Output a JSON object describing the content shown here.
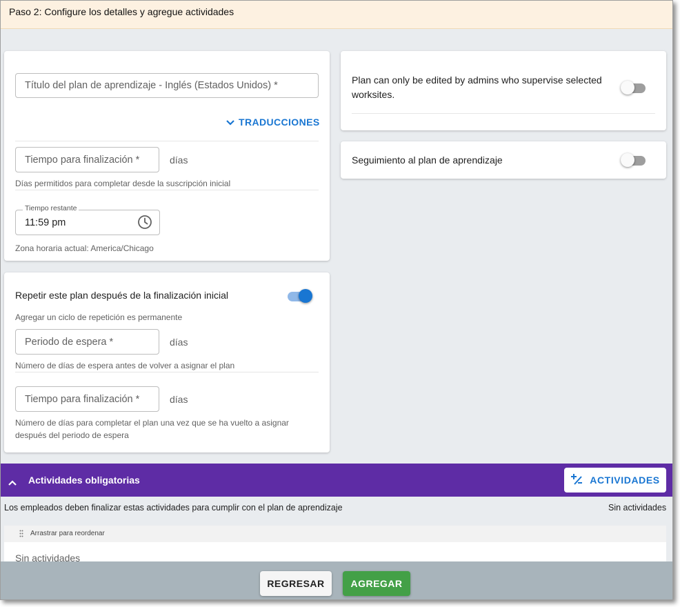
{
  "header": {
    "title": "Paso 2: Configure los detalles y agregue actividades"
  },
  "details_card": {
    "title_field_placeholder": "Título del plan de aprendizaje - Inglés (Estados Unidos) *",
    "translations_label": "TRADUCCIONES",
    "completion_field_placeholder": "Tiempo para finalización *",
    "completion_suffix": "días",
    "completion_helper": "Días permitidos para completar desde la suscripción inicial",
    "time_remaining_label": "Tiempo restante",
    "time_remaining_value": "11:59 pm",
    "timezone_text": "Zona horaria actual: America/Chicago"
  },
  "repeat_card": {
    "label": "Repetir este plan después de la finalización inicial",
    "toggle_on": true,
    "permanent_note": "Agregar un ciclo de repetición es permanente",
    "wait_field_placeholder": "Periodo de espera *",
    "wait_suffix": "días",
    "wait_helper": "Número de días de espera antes de volver a asignar el plan",
    "completion_field_placeholder": "Tiempo para finalización *",
    "completion_suffix": "días",
    "completion_helper_line1": "Número de días para completar el plan una vez que se ha vuelto a asignar",
    "completion_helper_line2": "después del periodo de espera"
  },
  "admin_card": {
    "label_line1": "Plan can only be edited by admins who supervise selected",
    "label_line2": "worksites.",
    "toggle_on": false
  },
  "tracking_card": {
    "label": "Seguimiento al plan de aprendizaje",
    "toggle_on": false
  },
  "activities_section": {
    "title": "Actividades obligatorias",
    "button_label": "ACTIVIDADES",
    "description": "Los empleados deben finalizar estas actividades para cumplir con el plan de aprendizaje",
    "count_text": "Sin actividades",
    "reorder_hint": "Arrastrar para reordenar",
    "empty_text": "Sin actividades"
  },
  "footer": {
    "back_label": "REGRESAR",
    "add_label": "AGREGAR"
  },
  "colors": {
    "accent_blue": "#1976d2",
    "section_purple": "#5e2ca5",
    "add_green": "#43a047",
    "header_bg": "#fdf1e1",
    "footer_bg": "#a8b4bb"
  },
  "icons": [
    "chevron-down-icon",
    "clock-icon",
    "chevron-up-icon",
    "add-activity-icon",
    "drag-handle-icon"
  ]
}
